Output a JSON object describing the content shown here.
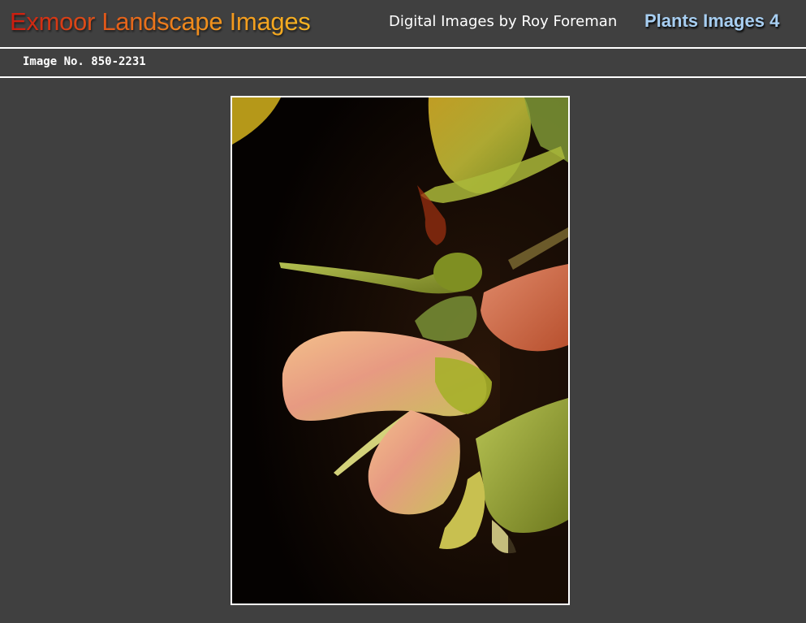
{
  "header": {
    "site_title": "Exmoor Landscape Images",
    "byline": "Digital Images by Roy Foreman",
    "gallery_title": "Plants Images 4"
  },
  "image_info": {
    "image_number": "Image No. 850-2231"
  },
  "colors": {
    "background": "#404040",
    "title_gradient_start": "#cc1b0f",
    "title_gradient_end": "#f6b422",
    "gallery_title": "#a8cff2",
    "rule": "#ffffff"
  },
  "photo": {
    "subject": "sycamore-seeds-photo"
  }
}
